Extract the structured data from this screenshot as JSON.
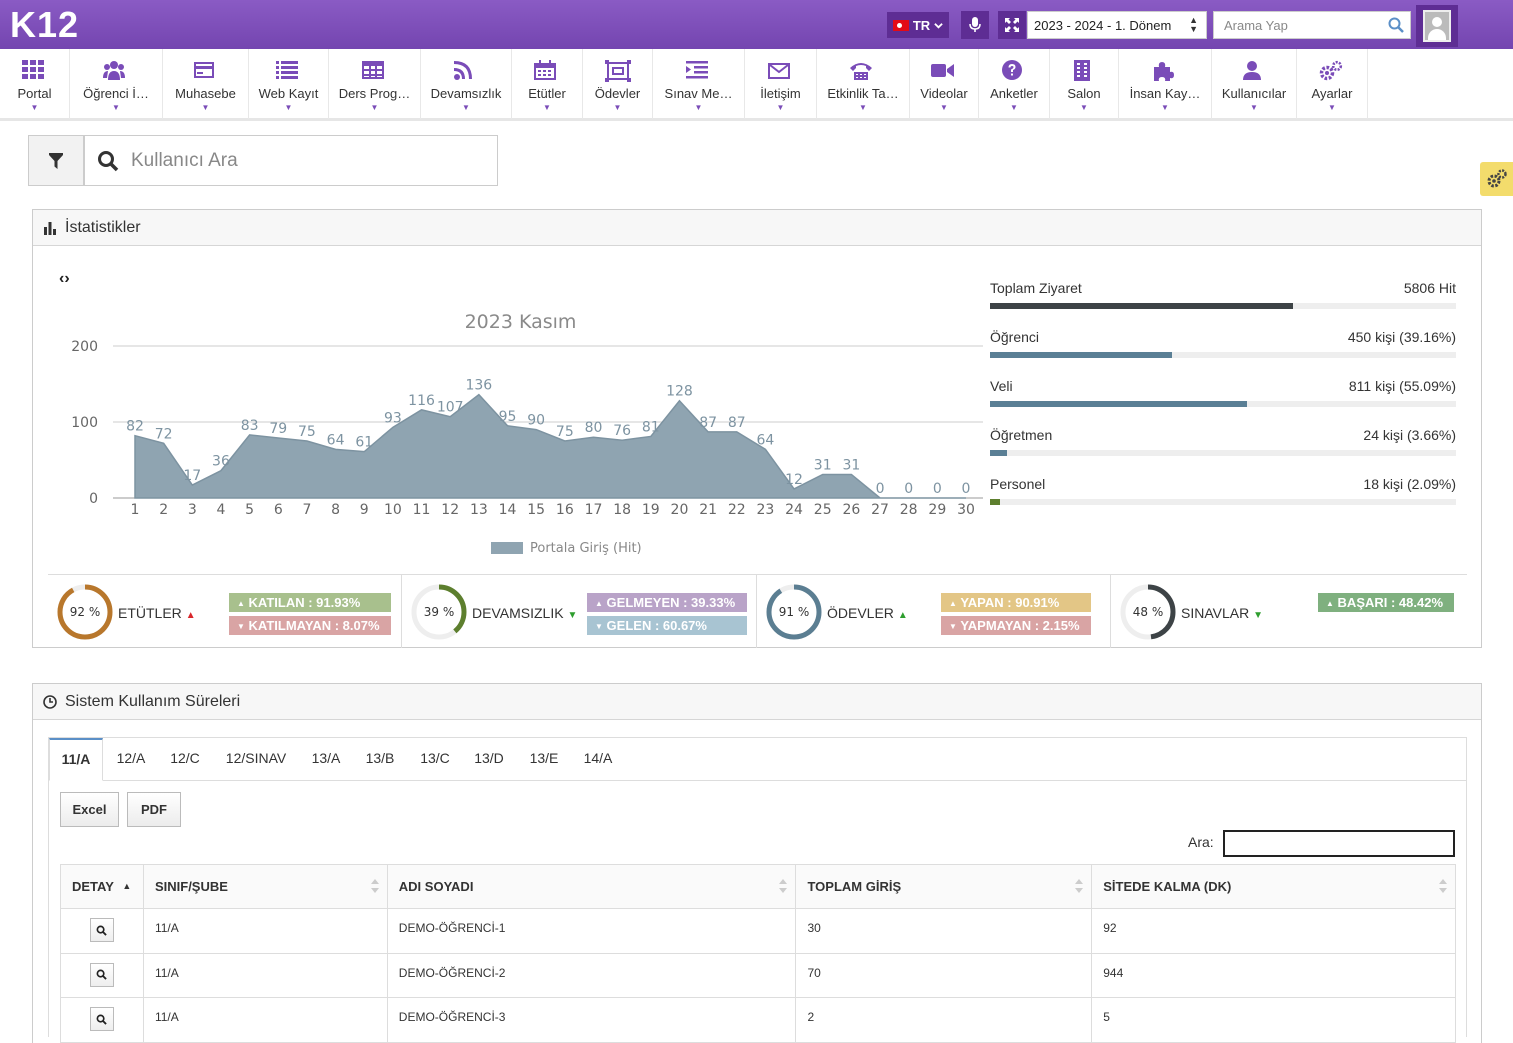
{
  "header": {
    "logo": "K12",
    "lang": "TR",
    "term": "2023 - 2024 - 1. Dönem",
    "search_placeholder": "Arama Yap"
  },
  "menu": [
    {
      "label": "Portal",
      "icon": "grid-icon"
    },
    {
      "label": "Öğrenci İ…",
      "icon": "users-icon"
    },
    {
      "label": "Muhasebe",
      "icon": "credit-card-icon"
    },
    {
      "label": "Web Kayıt",
      "icon": "list-icon"
    },
    {
      "label": "Ders Prog…",
      "icon": "table-icon"
    },
    {
      "label": "Devamsızlık",
      "icon": "rss-icon"
    },
    {
      "label": "Etütler",
      "icon": "calendar-icon"
    },
    {
      "label": "Ödevler",
      "icon": "frame-icon"
    },
    {
      "label": "Sınav Me…",
      "icon": "indent-icon"
    },
    {
      "label": "İletişim",
      "icon": "envelope-icon"
    },
    {
      "label": "Etkinlik Ta…",
      "icon": "phone-icon"
    },
    {
      "label": "Videolar",
      "icon": "video-icon"
    },
    {
      "label": "Anketler",
      "icon": "question-icon"
    },
    {
      "label": "Salon",
      "icon": "building-icon"
    },
    {
      "label": "İnsan Kay…",
      "icon": "puzzle-icon"
    },
    {
      "label": "Kullanıcılar",
      "icon": "user-icon"
    },
    {
      "label": "Ayarlar",
      "icon": "gears-icon"
    }
  ],
  "user_search": {
    "placeholder": "Kullanıcı Ara"
  },
  "stats_panel": {
    "title": "İstatistikler",
    "list": [
      {
        "label": "Toplam Ziyaret",
        "value": "5806 Hit",
        "pct": 65,
        "color": "#3d4346"
      },
      {
        "label": "Öğrenci",
        "value": "450 kişi (39.16%)",
        "pct": 39.16,
        "color": "#5a7f95"
      },
      {
        "label": "Veli",
        "value": "811 kişi (55.09%)",
        "pct": 55.09,
        "color": "#5a7f95"
      },
      {
        "label": "Öğretmen",
        "value": "24 kişi (3.66%)",
        "pct": 3.66,
        "color": "#5a7f95"
      },
      {
        "label": "Personel",
        "value": "18 kişi (2.09%)",
        "pct": 2.09,
        "color": "#5d7f2e"
      }
    ],
    "kpis": [
      {
        "pct": 92,
        "pct_text": "92 %",
        "name": "ETÜTLER",
        "ring_color": "#b8772c",
        "trend": "up",
        "trend_color": "#d9262a",
        "pills": [
          {
            "text": "KATILAN : 91.93%",
            "dir": "up",
            "color": "#a8c08d"
          },
          {
            "text": "KATILMAYAN : 8.07%",
            "dir": "down",
            "color": "#d9a4a4"
          }
        ]
      },
      {
        "pct": 39,
        "pct_text": "39 %",
        "name": "DEVAMSIZLIK",
        "ring_color": "#5d7f2e",
        "trend": "down",
        "trend_color": "#2e9e2e",
        "pills": [
          {
            "text": "GELMEYEN : 39.33%",
            "dir": "up",
            "color": "#b9a3c8"
          },
          {
            "text": "GELEN : 60.67%",
            "dir": "down",
            "color": "#a8c4d2"
          }
        ]
      },
      {
        "pct": 91,
        "pct_text": "91 %",
        "name": "ÖDEVLER",
        "ring_color": "#5b7e92",
        "trend": "up",
        "trend_color": "#2e9e2e",
        "pills": [
          {
            "text": "YAPAN : 90.91%",
            "dir": "up",
            "color": "#e3c686"
          },
          {
            "text": "YAPMAYAN : 2.15%",
            "dir": "down",
            "color": "#d9a4a4"
          }
        ]
      },
      {
        "pct": 48,
        "pct_text": "48 %",
        "name": "SINAVLAR",
        "ring_color": "#3d4346",
        "trend": "down",
        "trend_color": "#2e9e2e",
        "pills": [
          {
            "text": "BAŞARI : 48.42%",
            "dir": "up",
            "color": "#7fb07f"
          }
        ]
      }
    ]
  },
  "chart_data": {
    "type": "area",
    "title": "2023 Kasım",
    "x": [
      1,
      2,
      3,
      4,
      5,
      6,
      7,
      8,
      9,
      10,
      11,
      12,
      13,
      14,
      15,
      16,
      17,
      18,
      19,
      20,
      21,
      22,
      23,
      24,
      25,
      26,
      27,
      28,
      29,
      30
    ],
    "series": [
      {
        "name": "Portala Giriş (Hit)",
        "values": [
          82,
          72,
          17,
          36,
          83,
          79,
          75,
          64,
          61,
          93,
          116,
          107,
          136,
          95,
          90,
          75,
          80,
          76,
          81,
          128,
          87,
          87,
          64,
          12,
          31,
          31,
          0,
          0,
          0,
          0
        ]
      }
    ],
    "yticks": [
      0,
      100,
      200
    ],
    "ylim": [
      0,
      200
    ],
    "color": "#8fa4b1",
    "grid": true,
    "legend": "bottom"
  },
  "usage_panel": {
    "title": "Sistem Kullanım Süreleri",
    "tabs": [
      "11/A",
      "12/A",
      "12/C",
      "12/SINAV",
      "13/A",
      "13/B",
      "13/C",
      "13/D",
      "13/E",
      "14/A"
    ],
    "active_tab": 0,
    "export": {
      "excel": "Excel",
      "pdf": "PDF"
    },
    "search_label": "Ara:",
    "columns": [
      "DETAY",
      "SINIF/ŞUBE",
      "ADI SOYADI",
      "TOPLAM GİRİŞ",
      "SİTEDE KALMA (DK)"
    ],
    "rows": [
      [
        "11/A",
        "DEMO-ÖĞRENCİ-1",
        "30",
        "92"
      ],
      [
        "11/A",
        "DEMO-ÖĞRENCİ-2",
        "70",
        "944"
      ],
      [
        "11/A",
        "DEMO-ÖĞRENCİ-3",
        "2",
        "5"
      ]
    ]
  }
}
